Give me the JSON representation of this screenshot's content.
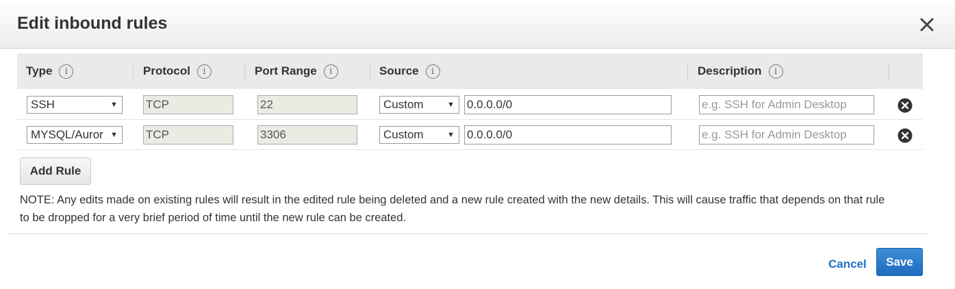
{
  "dialog": {
    "title": "Edit inbound rules"
  },
  "table": {
    "headers": {
      "type": "Type",
      "protocol": "Protocol",
      "port_range": "Port Range",
      "source": "Source",
      "description": "Description"
    },
    "info_glyph": "i",
    "rows": [
      {
        "type": "SSH",
        "protocol": "TCP",
        "port_range": "22",
        "source_type": "Custom",
        "source_value": "0.0.0.0/0",
        "description_placeholder": "e.g. SSH for Admin Desktop"
      },
      {
        "type": "MYSQL/Auror",
        "protocol": "TCP",
        "port_range": "3306",
        "source_type": "Custom",
        "source_value": "0.0.0.0/0",
        "description_placeholder": "e.g. SSH for Admin Desktop"
      }
    ]
  },
  "actions": {
    "add_rule": "Add Rule",
    "cancel": "Cancel",
    "save": "Save"
  },
  "note": "NOTE: Any edits made on existing rules will result in the edited rule being deleted and a new rule created with the new details. This will cause traffic that depends on that rule to be dropped for a very brief period of time until the new rule can be created.",
  "icons": {
    "close": "close-icon",
    "delete": "delete-circle-icon",
    "info": "info-icon",
    "dropdown": "chevron-down-icon"
  },
  "colors": {
    "primary_button": "#1d6bbd",
    "link": "#1f6fc5",
    "header_bg": "#eaeaea"
  }
}
